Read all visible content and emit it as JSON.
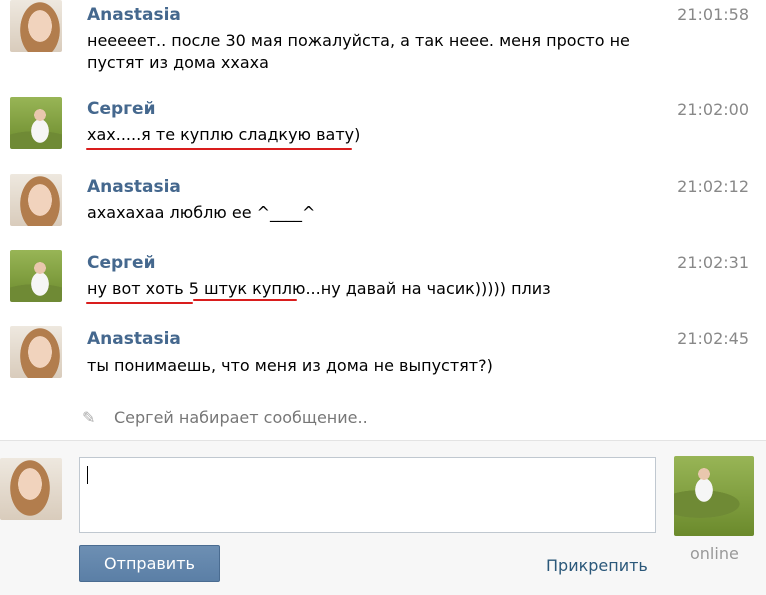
{
  "messages": [
    {
      "author": "Anastasia",
      "time": "21:01:58",
      "text": "неееeет.. после 30 мая пожалуйста, а так неее. меня просто не пустят из дома ххаха",
      "avatar_icon": "girl-avatar"
    },
    {
      "author": "Сергей",
      "time": "21:02:00",
      "text": "хах.....я те куплю сладкую вату)",
      "avatar_icon": "boy-avatar"
    },
    {
      "author": "Anastasia",
      "time": "21:02:12",
      "text": "ахахахаа люблю ее ^____^",
      "avatar_icon": "girl-avatar"
    },
    {
      "author": "Сергей",
      "time": "21:02:31",
      "text": "ну вот хоть 5 штук куплю...ну давай на часик))))) плиз",
      "avatar_icon": "boy-avatar"
    },
    {
      "author": "Anastasia",
      "time": "21:02:45",
      "text": "ты понимаешь, что меня из дома не выпустят?)",
      "avatar_icon": "girl-avatar"
    }
  ],
  "typing_indicator": {
    "text": "Сергей набирает сообщение..",
    "icon": "pencil-icon"
  },
  "composer": {
    "value": "",
    "send_label": "Отправить",
    "attach_label": "Прикрепить",
    "peer_status": "online"
  },
  "colors": {
    "name": "#45688e",
    "underline": "#d91d1d",
    "button": "#5b7fa6",
    "link": "#2b587a"
  }
}
